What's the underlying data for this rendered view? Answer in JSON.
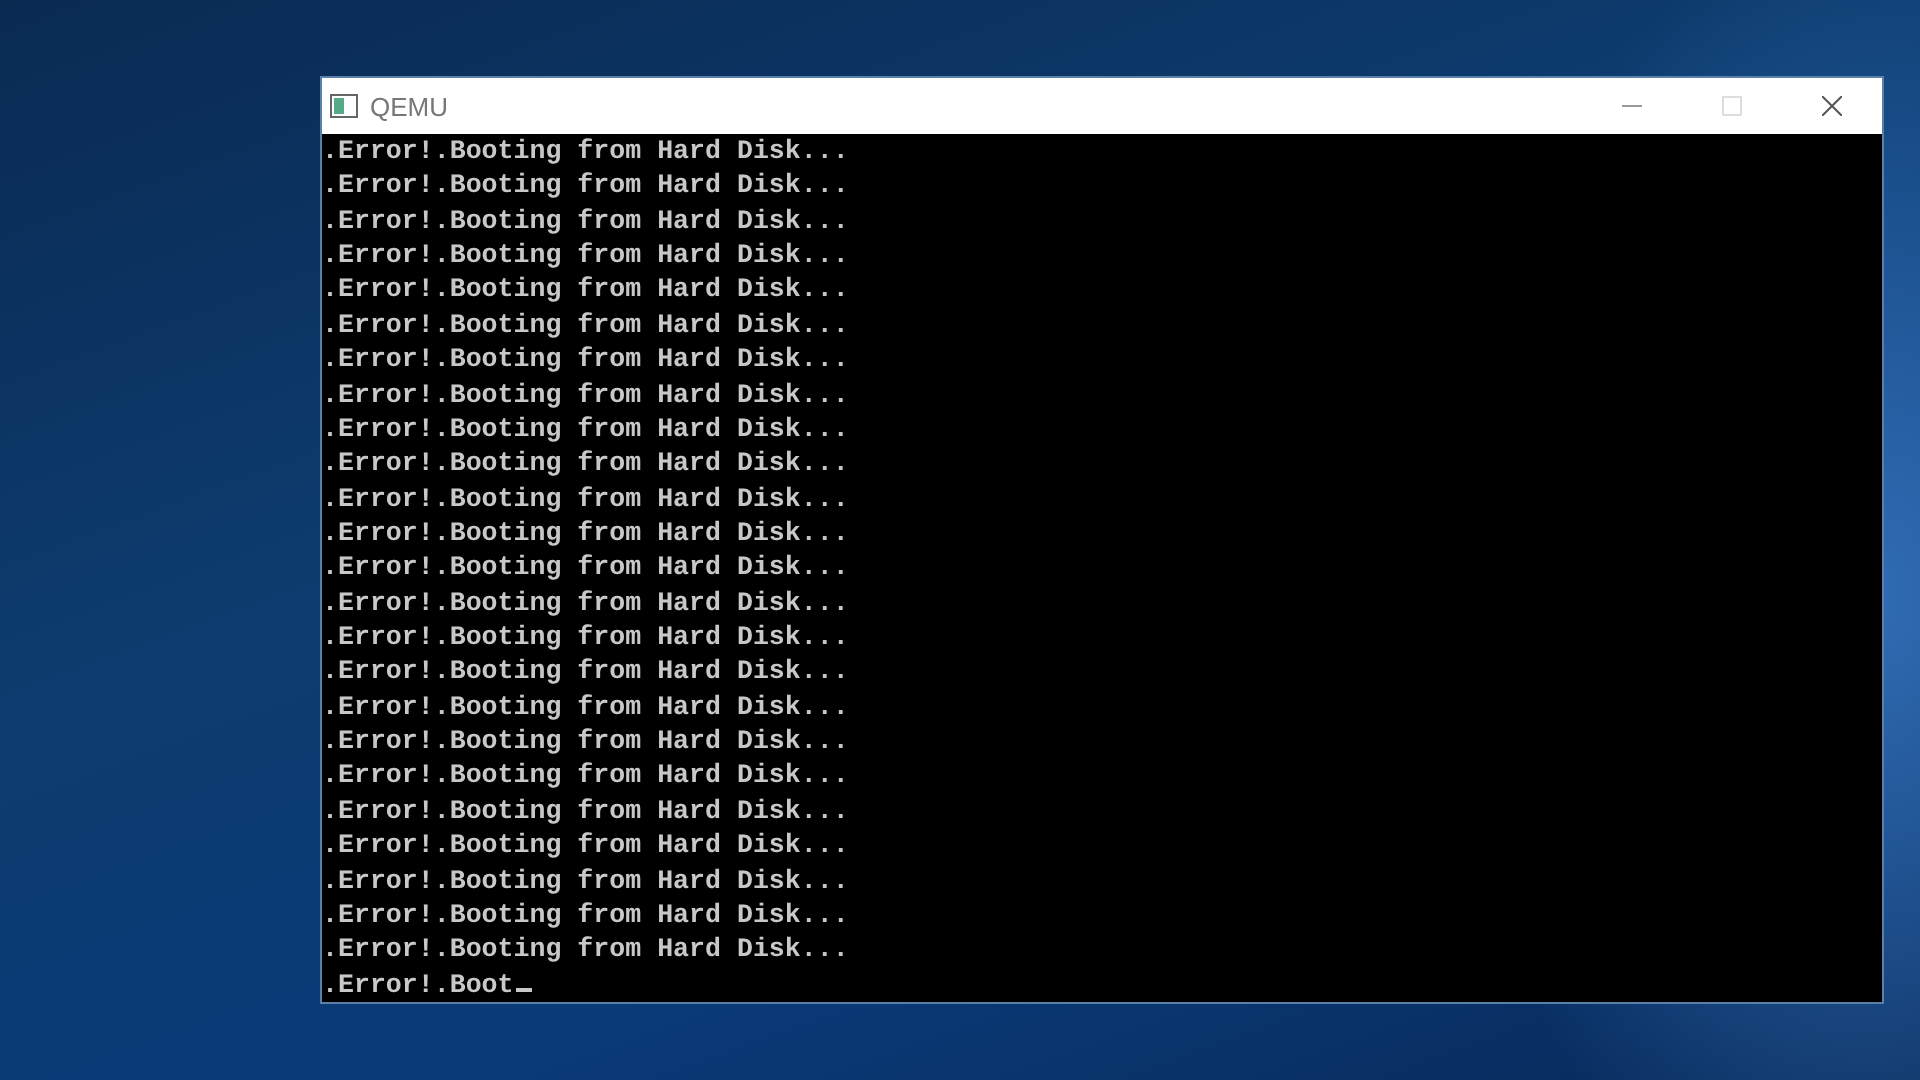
{
  "window": {
    "title": "QEMU"
  },
  "console": {
    "lines": [
      ".Error!.Booting from Hard Disk...",
      ".Error!.Booting from Hard Disk...",
      ".Error!.Booting from Hard Disk...",
      ".Error!.Booting from Hard Disk...",
      ".Error!.Booting from Hard Disk...",
      ".Error!.Booting from Hard Disk...",
      ".Error!.Booting from Hard Disk...",
      ".Error!.Booting from Hard Disk...",
      ".Error!.Booting from Hard Disk...",
      ".Error!.Booting from Hard Disk...",
      ".Error!.Booting from Hard Disk...",
      ".Error!.Booting from Hard Disk...",
      ".Error!.Booting from Hard Disk...",
      ".Error!.Booting from Hard Disk...",
      ".Error!.Booting from Hard Disk...",
      ".Error!.Booting from Hard Disk...",
      ".Error!.Booting from Hard Disk...",
      ".Error!.Booting from Hard Disk...",
      ".Error!.Booting from Hard Disk...",
      ".Error!.Booting from Hard Disk...",
      ".Error!.Booting from Hard Disk...",
      ".Error!.Booting from Hard Disk...",
      ".Error!.Booting from Hard Disk...",
      ".Error!.Booting from Hard Disk...",
      ".Error!.Boot"
    ],
    "cursor_visible": true
  }
}
